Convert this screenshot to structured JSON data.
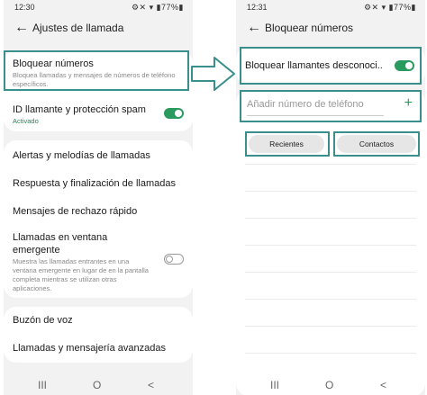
{
  "left_screen": {
    "status": {
      "time": "12:30",
      "icons": "⚙✕ ▾ ▮77%▮"
    },
    "back_icon": "←",
    "title": "Ajustes de llamada",
    "block_numbers": {
      "title": "Bloquear números",
      "subtitle": "Bloquea llamadas y mensajes de números de teléfono específicos."
    },
    "caller_id": {
      "title": "ID llamante y protección spam",
      "subtitle": "Activado",
      "toggle": true
    },
    "menu_items": [
      "Alertas y melodías de llamadas",
      "Respuesta y finalización de llamadas",
      "Mensajes de rechazo rápido"
    ],
    "popup_calls": {
      "title": "Llamadas en ventana emergente",
      "subtitle": "Muestra las llamadas entrantes en una ventana emergente en lugar de en la pantalla completa mientras se utilizan otras aplicaciones.",
      "toggle": false
    },
    "bottom_items": [
      "Buzón de voz",
      "Llamadas y mensajería avanzadas"
    ],
    "nav": {
      "recents": "III",
      "home": "O",
      "back": "<"
    }
  },
  "right_screen": {
    "status": {
      "time": "12:31",
      "icons": "⚙✕ ▾ ▮77%▮"
    },
    "back_icon": "←",
    "title": "Bloquear números",
    "block_unknown": {
      "label": "Bloquear llamantes desconoci..",
      "toggle": true
    },
    "add_number": {
      "placeholder": "Añadir número de teléfono",
      "plus": "+"
    },
    "buttons": {
      "recents": "Recientes",
      "contacts": "Contactos"
    },
    "nav": {
      "recents": "III",
      "home": "O",
      "back": "<"
    }
  },
  "colors": {
    "accent_green": "#2a9a5e",
    "highlight": "#3a8f8c",
    "background": "#f2f2f2"
  }
}
